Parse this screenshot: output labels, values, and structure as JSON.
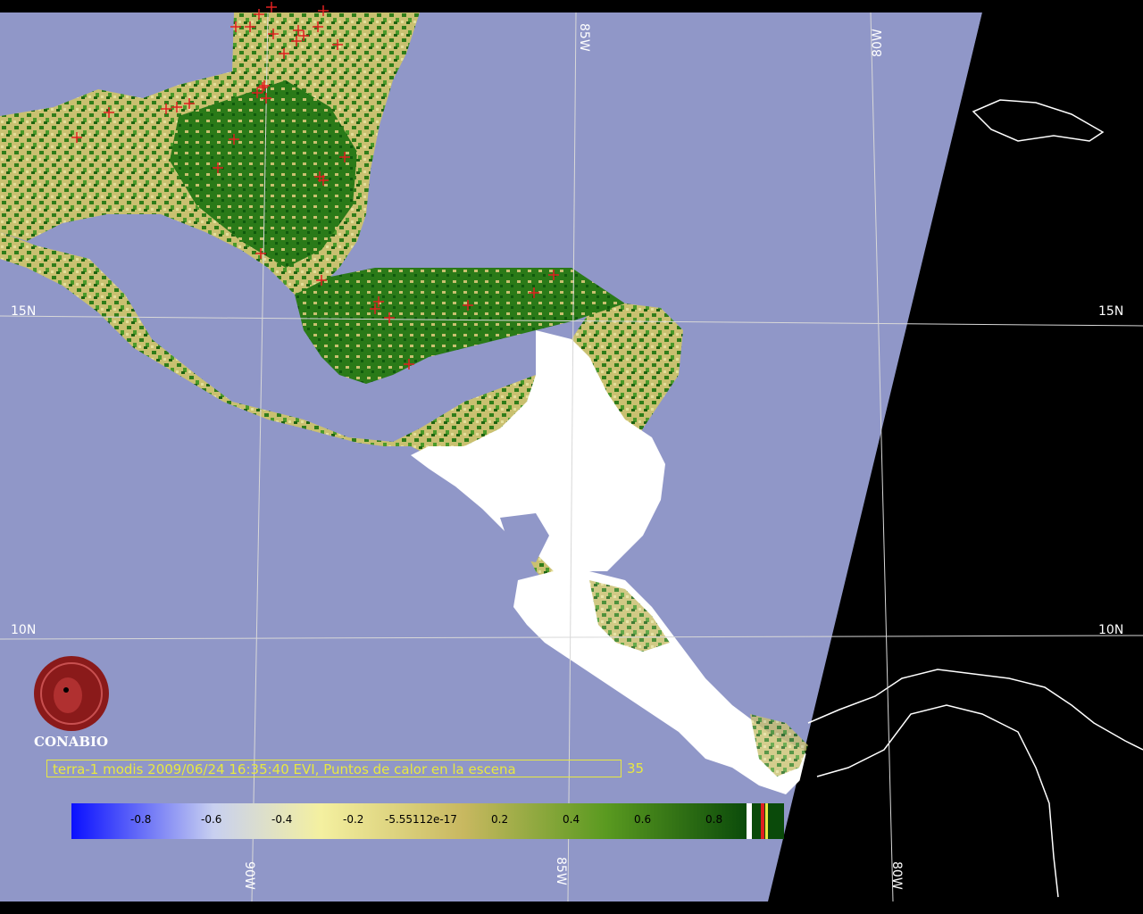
{
  "map": {
    "latitude_labels": [
      "15N",
      "15N",
      "10N",
      "10N"
    ],
    "longitude_labels": [
      "85W",
      "80W",
      "90W",
      "85W",
      "80W"
    ],
    "colors": {
      "ocean": "#9097c8",
      "no_data": "#000000",
      "land_cloud": "#ffffff",
      "coast_outline": "#ffffff",
      "fire_marker": "#e02020",
      "graticule": "#d8d8d8"
    }
  },
  "logo": {
    "name": "CONABIO",
    "icon": "conabio-emblem-icon",
    "color": "#8a1a1a"
  },
  "caption": {
    "text": "terra-1 modis 2009/06/24 16:35:40 EVI, Puntos de calor en la escena",
    "count": "35",
    "color": "#e8e840"
  },
  "colorbar": {
    "ticks": [
      "-0.8",
      "-0.6",
      "-0.4",
      "-0.2",
      "-5.55112e-17",
      "0.2",
      "0.4",
      "0.6",
      "0.8"
    ],
    "colors": [
      "#0a10ff",
      "#c8d0f0",
      "#f4f0a0",
      "#c8b860",
      "#5a9a20",
      "#0a4a0a"
    ]
  },
  "fire_points": 35
}
